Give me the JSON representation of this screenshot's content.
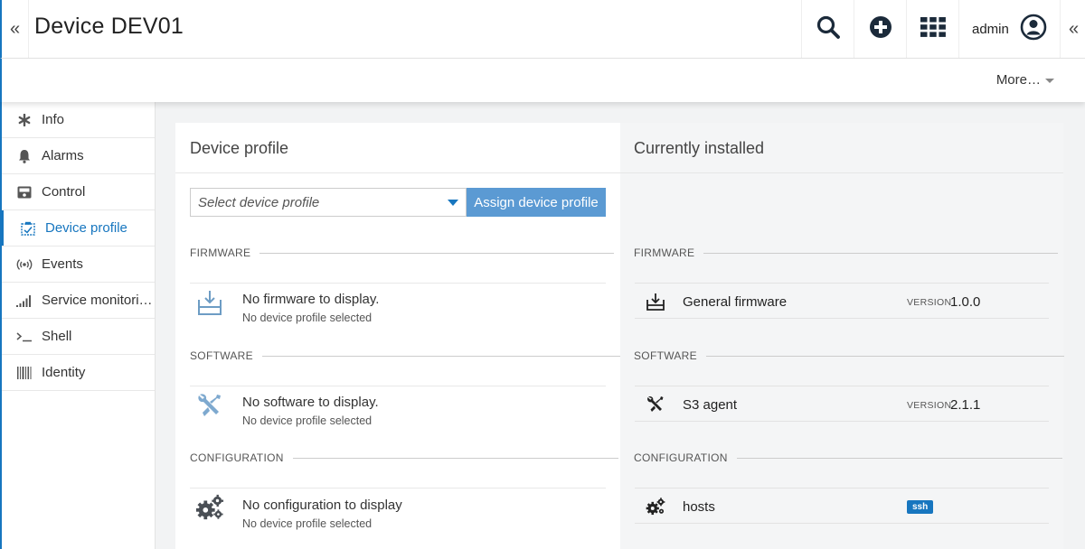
{
  "header": {
    "collapse_left": "«",
    "title": "Device DEV01",
    "user_name": "admin",
    "collapse_right": "«"
  },
  "subheader": {
    "more_label": "More…"
  },
  "sidebar": {
    "items": [
      {
        "label": "Info",
        "icon": "asterisk-icon"
      },
      {
        "label": "Alarms",
        "icon": "bell-icon"
      },
      {
        "label": "Control",
        "icon": "control-icon"
      },
      {
        "label": "Device profile",
        "icon": "device-profile-icon",
        "active": true
      },
      {
        "label": "Events",
        "icon": "broadcast-icon"
      },
      {
        "label": "Service monitori…",
        "icon": "signal-bars-icon"
      },
      {
        "label": "Shell",
        "icon": "terminal-icon"
      },
      {
        "label": "Identity",
        "icon": "barcode-icon"
      }
    ]
  },
  "device_profile": {
    "title": "Device profile",
    "select_placeholder": "Select device profile",
    "assign_button": "Assign device profile",
    "firmware": {
      "label": "FIRMWARE",
      "empty_title": "No firmware to display.",
      "empty_sub": "No device profile selected"
    },
    "software": {
      "label": "SOFTWARE",
      "empty_title": "No software to display.",
      "empty_sub": "No device profile selected"
    },
    "configuration": {
      "label": "CONFIGURATION",
      "empty_title": "No configuration to display",
      "empty_sub": "No device profile selected"
    }
  },
  "installed": {
    "title": "Currently installed",
    "firmware": {
      "label": "FIRMWARE",
      "name": "General firmware",
      "version_label": "VERSION",
      "version": "1.0.0"
    },
    "software": {
      "label": "SOFTWARE",
      "name": "S3 agent",
      "version_label": "VERSION",
      "version": "2.1.1"
    },
    "configuration": {
      "label": "CONFIGURATION",
      "name": "hosts",
      "badge": "ssh"
    }
  },
  "colors": {
    "accent": "#1776bf",
    "button": "#5b9ad3",
    "panel_right": "#f4f5f6"
  }
}
